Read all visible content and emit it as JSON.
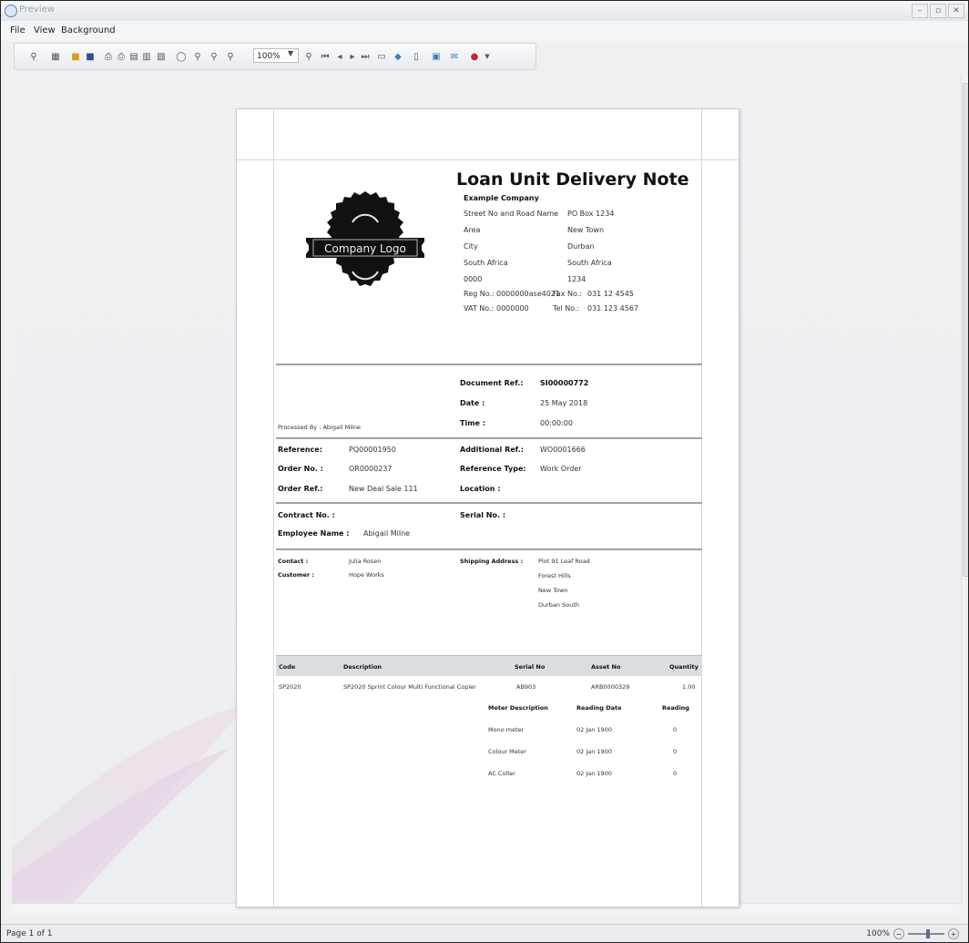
{
  "window": {
    "title": "Preview",
    "controls": [
      "–",
      "▫",
      "✕"
    ]
  },
  "menu": [
    "File",
    "View",
    "Background"
  ],
  "toolbar": {
    "zoom_value": "100%"
  },
  "status": {
    "page": "Page 1 of 1",
    "zoom": "100%"
  },
  "document": {
    "title": "Loan Unit Delivery Note",
    "logo_text": "Company Logo",
    "company": {
      "name": "Example Company",
      "street": [
        "Street No and Road Name",
        "Area",
        "City",
        "South Africa",
        "0000"
      ],
      "postal": [
        "PO Box 1234",
        "New Town",
        "Durban",
        "South Africa",
        "1234"
      ],
      "reg_label": "Reg No.:",
      "reg_value": "0000000ase4021",
      "fax_label": "Fax No.:",
      "fax_value": "031 12 4545",
      "vat_label": "VAT No.:",
      "vat_value": "0000000",
      "tel_label": "Tel No.:",
      "tel_value": "031 123 4567"
    },
    "meta": {
      "doc_ref_label": "Document Ref.:",
      "doc_ref_value": "SI00000772",
      "date_label": "Date :",
      "date_value": "25 May 2018",
      "time_label": "Time :",
      "time_value": "00:00:00",
      "processed_by": "Processed By : Abigail Milne"
    },
    "refs": {
      "reference_label": "Reference:",
      "reference_value": "PQ00001950",
      "order_no_label": "Order No. :",
      "order_no_value": "OR0000237",
      "order_ref_label": "Order Ref.:",
      "order_ref_value": "New Deal Sale 111",
      "add_ref_label": "Additional Ref.:",
      "add_ref_value": "WO0001666",
      "ref_type_label": "Reference Type:",
      "ref_type_value": "Work Order",
      "location_label": "Location :"
    },
    "contract": {
      "contract_label": "Contract No. :",
      "serial_label": "Serial No. :",
      "employee_label": "Employee Name :",
      "employee_value": "Abigail Milne"
    },
    "contact": {
      "contact_label": "Contact :",
      "contact_value": "Julia Rosen",
      "customer_label": "Customer :",
      "customer_value": "Hope Works",
      "shipping_label": "Shipping Address :",
      "shipping_lines": [
        "Plot 91 Leaf Road",
        "Forest Hills",
        "New Town",
        "Durban South"
      ]
    },
    "items": {
      "headers": {
        "code": "Code",
        "description": "Description",
        "serial": "Serial No",
        "asset": "Asset No",
        "quantity": "Quantity"
      },
      "row": {
        "code": "SP2020",
        "description": "SP2020 Sprint Colour Multi Functional Copier",
        "serial": "AB903",
        "asset": "ARB0000329",
        "quantity": "1.00"
      },
      "meter_headers": {
        "desc": "Meter Description",
        "date": "Reading Date",
        "reading": "Reading"
      },
      "meters": [
        {
          "desc": "Mono meter",
          "date": "02 Jan 1900",
          "reading": "0"
        },
        {
          "desc": "Colour Meter",
          "date": "02 Jan 1900",
          "reading": "0"
        },
        {
          "desc": "AC Coller",
          "date": "02 Jan 1900",
          "reading": "0"
        }
      ]
    }
  }
}
